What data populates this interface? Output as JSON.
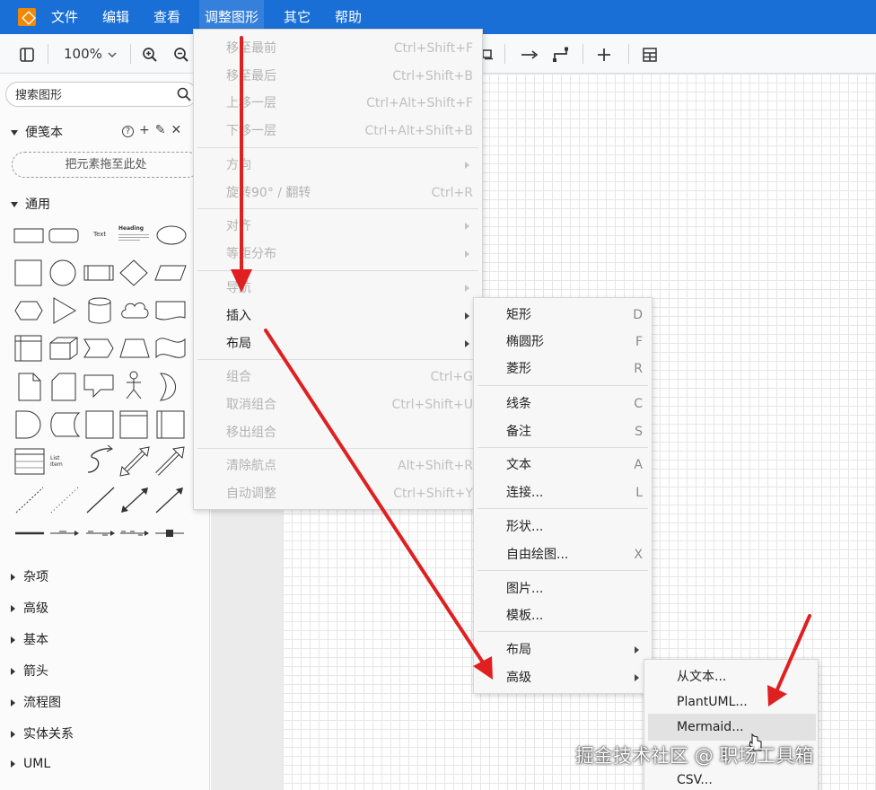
{
  "menubar": {
    "items": [
      {
        "label": "文件"
      },
      {
        "label": "编辑"
      },
      {
        "label": "查看"
      },
      {
        "label": "调整图形"
      },
      {
        "label": "其它"
      },
      {
        "label": "帮助"
      }
    ]
  },
  "toolbar": {
    "zoom": "100%"
  },
  "sidebar": {
    "search_placeholder": "搜索图形",
    "scratchpad_title": "便笺本",
    "scratchpad_tools": [
      "?",
      "+",
      "✎",
      "✕"
    ],
    "dropzone": "把元素拖至此处",
    "general_title": "通用",
    "shape_text_label": "Text",
    "shape_heading_label": "Heading",
    "shape_listitem_label": "List Item",
    "collapsed_sections": [
      "杂项",
      "高级",
      "基本",
      "箭头",
      "流程图",
      "实体关系",
      "UML"
    ]
  },
  "menu_arrange": {
    "items": [
      {
        "label": "移至最前",
        "shortcut": "Ctrl+Shift+F"
      },
      {
        "label": "移至最后",
        "shortcut": "Ctrl+Shift+B"
      },
      {
        "label": "上移一层",
        "shortcut": "Ctrl+Alt+Shift+F"
      },
      {
        "label": "下移一层",
        "shortcut": "Ctrl+Alt+Shift+B"
      },
      {
        "label": "方向",
        "shortcut": ""
      },
      {
        "label": "旋转90° / 翻转",
        "shortcut": "Ctrl+R"
      },
      {
        "label": "对齐",
        "shortcut": ""
      },
      {
        "label": "等距分布",
        "shortcut": ""
      },
      {
        "label": "导航",
        "shortcut": ""
      },
      {
        "label": "插入",
        "shortcut": ""
      },
      {
        "label": "布局",
        "shortcut": ""
      },
      {
        "label": "组合",
        "shortcut": "Ctrl+G"
      },
      {
        "label": "取消组合",
        "shortcut": "Ctrl+Shift+U"
      },
      {
        "label": "移出组合",
        "shortcut": ""
      },
      {
        "label": "清除航点",
        "shortcut": "Alt+Shift+R"
      },
      {
        "label": "自动调整",
        "shortcut": "Ctrl+Shift+Y"
      }
    ]
  },
  "menu_insert": {
    "items": [
      {
        "label": "矩形",
        "shortcut": "D"
      },
      {
        "label": "椭圆形",
        "shortcut": "F"
      },
      {
        "label": "菱形",
        "shortcut": "R"
      },
      {
        "label": "线条",
        "shortcut": "C"
      },
      {
        "label": "备注",
        "shortcut": "S"
      },
      {
        "label": "文本",
        "shortcut": "A"
      },
      {
        "label": "连接...",
        "shortcut": "L"
      },
      {
        "label": "形状...",
        "shortcut": ""
      },
      {
        "label": "自由绘图...",
        "shortcut": "X"
      },
      {
        "label": "图片...",
        "shortcut": ""
      },
      {
        "label": "模板...",
        "shortcut": ""
      },
      {
        "label": "布局",
        "shortcut": ""
      },
      {
        "label": "高级",
        "shortcut": ""
      }
    ]
  },
  "menu_advanced": {
    "items": [
      {
        "label": "从文本..."
      },
      {
        "label": "PlantUML..."
      },
      {
        "label": "Mermaid..."
      },
      {
        "label": "CSV..."
      }
    ]
  },
  "watermark": "掘金技术社区 @ 职场工具箱",
  "colors": {
    "menubar": "#1a6fd6",
    "annotation_arrow": "#e02020"
  }
}
